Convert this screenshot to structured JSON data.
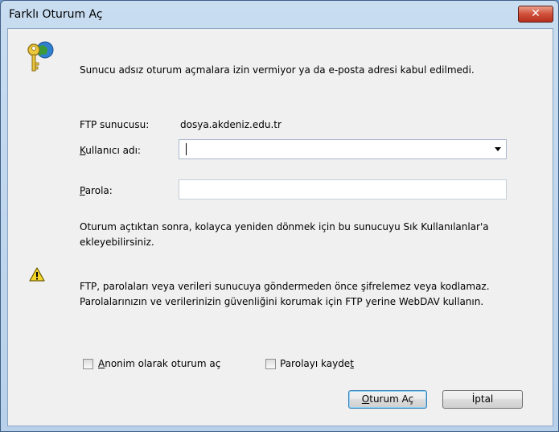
{
  "window": {
    "title": "Farklı Oturum Aç",
    "close_glyph": "✕"
  },
  "message": "Sunucu adsız oturum açmalara izin vermiyor ya da e-posta adresi kabul edilmedi.",
  "ftp_server": {
    "label": "FTP sunucusu:",
    "value": "dosya.akdeniz.edu.tr"
  },
  "username": {
    "label_rest": "ullanıcı adı:",
    "label_mnemonic": "K",
    "value": ""
  },
  "password": {
    "label_rest": "arola:",
    "label_mnemonic": "P",
    "value": ""
  },
  "info_text": "Oturum açtıktan sonra, kolayca yeniden dönmek için bu sunucuyu Sık Kullanılanlar'a eklеyebilirsiniz.",
  "warning_text": "FTP, parolaları veya verileri sunucuya göndermeden önce şifrelemez veya kodlamaz. Parolalarınızın ve verilerinizin güvenliğini korumak için FTP yerine WebDAV kullanın.",
  "anonymous_checkbox": {
    "mnemonic": "A",
    "rest": "nonim olarak oturum aç",
    "checked": false
  },
  "save_password_checkbox": {
    "before": "Parolayı kayde",
    "mnemonic": "t",
    "checked": false
  },
  "buttons": {
    "login": {
      "mnemonic": "O",
      "rest": "turum Aç"
    },
    "cancel": {
      "label": "İptal"
    }
  }
}
